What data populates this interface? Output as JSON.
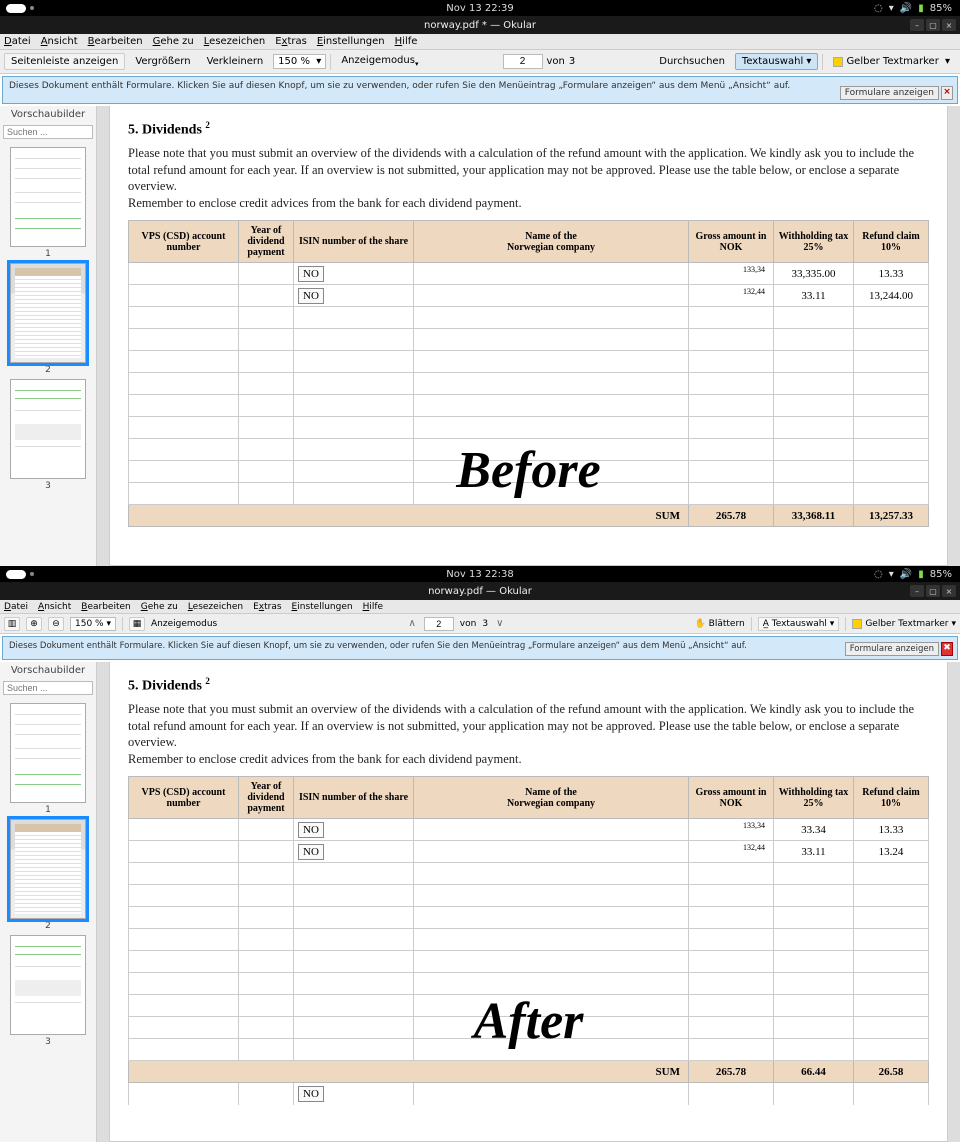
{
  "sys": {
    "time_before": "Nov 13  22:39",
    "time_after": "Nov 13  22:38",
    "battery": "85%"
  },
  "title_before": "norway.pdf * — Okular",
  "title_after": "norway.pdf — Okular",
  "menu": {
    "datei": "Datei",
    "ansicht": "Ansicht",
    "bearbeiten": "Bearbeiten",
    "gehe": "Gehe zu",
    "lesezeichen": "Lesezeichen",
    "extras": "Extras",
    "einstellungen": "Einstellungen",
    "hilfe": "Hilfe"
  },
  "tb1": {
    "sidebar": "Seitenleiste anzeigen",
    "zoomin": "Vergrößern",
    "zoomout": "Verkleinern",
    "zoom": "150 %",
    "anzeige": "Anzeigemodus",
    "page": "2",
    "von": "von",
    "total": "3",
    "durchsuchen": "Durchsuchen",
    "textauswahl": "Textauswahl",
    "highlighter": "Gelber Textmarker"
  },
  "tb2": {
    "zoom": "150 %",
    "anzeige": "Anzeigemodus",
    "page": "2",
    "von": "von",
    "total": "3",
    "blattern": "Blättern",
    "textauswahl": "Textauswahl",
    "highlighter": "Gelber Textmarker"
  },
  "banner": {
    "text": "Dieses Dokument enthält Formulare. Klicken Sie auf diesen Knopf, um sie zu verwenden, oder rufen Sie den Menüeintrag „Formulare anzeigen“ aus dem Menü „Ansicht“ auf.",
    "btn": "Formulare anzeigen"
  },
  "sidebar": {
    "head": "Vorschaubilder",
    "search_ph": "Suchen ..."
  },
  "doc": {
    "heading": "5. Dividends",
    "sup": "2",
    "p1": "Please note that you must submit an overview of the dividends with a calculation of the refund amount with the application. We kindly ask you to include the total refund amount for each year. If an overview is not submitted, your application may not be approved. Please use the table below, or enclose a separate overview.",
    "p2": "Remember to enclose credit advices from the bank for each dividend payment.",
    "th": {
      "vps": "VPS (CSD) account number",
      "year": "Year of dividend payment",
      "isin": "ISIN number of the share",
      "name1": "Name of the",
      "name2": "Norwegian company",
      "gross": "Gross amount in NOK",
      "with": "Withholding tax 25%",
      "ref": "Refund claim 10%"
    },
    "no": "NO",
    "sum": "SUM"
  },
  "before_rows": {
    "r1": {
      "gross": "133,34",
      "with": "33,335.00",
      "ref": "13.33"
    },
    "r2": {
      "gross": "132,44",
      "with": "33.11",
      "ref": "13,244.00"
    },
    "sum": {
      "gross": "265.78",
      "with": "33,368.11",
      "ref": "13,257.33"
    }
  },
  "after_rows": {
    "r1": {
      "gross": "133,34",
      "with": "33.34",
      "ref": "13.33"
    },
    "r2": {
      "gross": "132,44",
      "with": "33.11",
      "ref": "13.24"
    },
    "sum": {
      "gross": "265.78",
      "with": "66.44",
      "ref": "26.58"
    }
  },
  "wm": {
    "before": "Before",
    "after": "After"
  }
}
